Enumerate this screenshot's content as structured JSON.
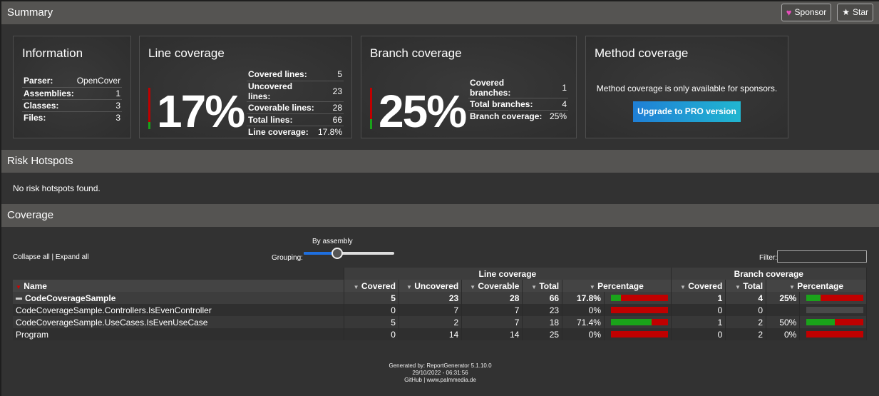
{
  "header": {
    "title": "Summary",
    "sponsor_label": "Sponsor",
    "star_label": "Star"
  },
  "information": {
    "title": "Information",
    "rows": [
      {
        "label": "Parser:",
        "value": "OpenCover"
      },
      {
        "label": "Assemblies:",
        "value": "1"
      },
      {
        "label": "Classes:",
        "value": "3"
      },
      {
        "label": "Files:",
        "value": "3"
      }
    ]
  },
  "line_coverage": {
    "title": "Line coverage",
    "big_value": "17%",
    "gauge_fraction": 0.178,
    "rows": [
      {
        "label": "Covered lines:",
        "value": "5"
      },
      {
        "label": "Uncovered lines:",
        "value": "23"
      },
      {
        "label": "Coverable lines:",
        "value": "28"
      },
      {
        "label": "Total lines:",
        "value": "66"
      },
      {
        "label": "Line coverage:",
        "value": "17.8%"
      }
    ]
  },
  "branch_coverage": {
    "title": "Branch coverage",
    "big_value": "25%",
    "gauge_fraction": 0.25,
    "rows": [
      {
        "label": "Covered branches:",
        "value": "1"
      },
      {
        "label": "Total branches:",
        "value": "4"
      },
      {
        "label": "Branch coverage:",
        "value": "25%"
      }
    ]
  },
  "method_coverage": {
    "title": "Method coverage",
    "text": "Method coverage is only available for sponsors.",
    "button_label": "Upgrade to PRO version"
  },
  "risk_hotspots": {
    "title": "Risk Hotspots",
    "text": "No risk hotspots found."
  },
  "coverage": {
    "title": "Coverage",
    "collapse_all": "Collapse all",
    "separator": "|",
    "expand_all": "Expand all",
    "grouping_label": "Grouping:",
    "grouping_value": "By assembly",
    "grouping_slider_fraction": 0.35,
    "filter_label": "Filter:",
    "filter_value": "",
    "group_headers": {
      "line": "Line coverage",
      "branch": "Branch coverage"
    },
    "columns": {
      "name": "Name",
      "covered": "Covered",
      "uncovered": "Uncovered",
      "coverable": "Coverable",
      "total": "Total",
      "percentage": "Percentage",
      "b_covered": "Covered",
      "b_total": "Total",
      "b_percentage": "Percentage"
    },
    "assembly": {
      "name": "CodeCoverageSample",
      "covered": "5",
      "uncovered": "23",
      "coverable": "28",
      "total": "66",
      "percentage": "17.8%",
      "line_fraction": 0.178,
      "b_covered": "1",
      "b_total": "4",
      "b_percentage": "25%",
      "branch_fraction": 0.25
    },
    "rows": [
      {
        "name": "CodeCoverageSample.Controllers.IsEvenController",
        "covered": "0",
        "uncovered": "7",
        "coverable": "7",
        "total": "23",
        "percentage": "0%",
        "line_fraction": 0,
        "b_covered": "0",
        "b_total": "0",
        "b_percentage": "",
        "branch_fraction": null
      },
      {
        "name": "CodeCoverageSample.UseCases.IsEvenUseCase",
        "covered": "5",
        "uncovered": "2",
        "coverable": "7",
        "total": "18",
        "percentage": "71.4%",
        "line_fraction": 0.714,
        "b_covered": "1",
        "b_total": "2",
        "b_percentage": "50%",
        "branch_fraction": 0.5
      },
      {
        "name": "Program",
        "covered": "0",
        "uncovered": "14",
        "coverable": "14",
        "total": "25",
        "percentage": "0%",
        "line_fraction": 0,
        "b_covered": "0",
        "b_total": "2",
        "b_percentage": "0%",
        "branch_fraction": 0
      }
    ]
  },
  "footer": {
    "generated_by": "Generated by: ReportGenerator 5.1.10.0",
    "timestamp": "29/10/2022 - 06:31:56",
    "github": "GitHub",
    "separator": "|",
    "website": "www.palmmedia.de"
  },
  "colors": {
    "covered": "#1aa31a",
    "uncovered": "#c00000",
    "accent": "#1f7fd6"
  }
}
